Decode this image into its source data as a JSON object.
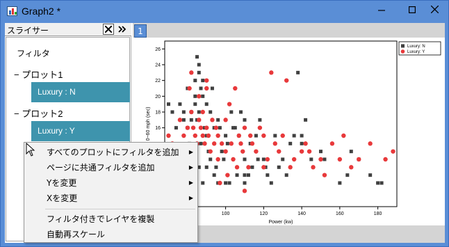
{
  "window": {
    "title": "Graph2 *"
  },
  "slicer": {
    "title": "スライサー",
    "filter_label": "フィルタ",
    "groups": [
      {
        "label": "− プロット1",
        "item": "Luxury : N"
      },
      {
        "label": "− プロット2",
        "item": "Luxury : Y"
      }
    ]
  },
  "graph": {
    "layer_tab": "1"
  },
  "context_menu": {
    "items": [
      {
        "label": "すべてのプロットにフィルタを追加",
        "submenu": true
      },
      {
        "label": "ページに共通フィルタを追加",
        "submenu": true
      },
      {
        "label": "Yを変更",
        "submenu": true
      },
      {
        "label": "Xを変更",
        "submenu": true
      },
      {
        "label": "フィルタ付きでレイヤを複製",
        "submenu": false
      },
      {
        "label": "自動再スケール",
        "submenu": false
      }
    ]
  },
  "colors": {
    "accent": "#5a8ed6",
    "selected": "#3e94ad",
    "series_n": "#404040",
    "series_y": "#e8393b"
  },
  "chart_data": {
    "type": "scatter",
    "xlabel": "Power (kw)",
    "ylabel": "0~60 mph (sec)",
    "xlim": [
      68,
      190
    ],
    "ylim": [
      6,
      27
    ],
    "xticks": [
      80,
      100,
      120,
      140,
      160,
      180
    ],
    "yticks": [
      8,
      10,
      12,
      14,
      16,
      18,
      20,
      22,
      24,
      26
    ],
    "legend_position": "top-right",
    "series": [
      {
        "name": "Luxury: N",
        "marker": "square",
        "points": [
          [
            70,
            19
          ],
          [
            72,
            18
          ],
          [
            74,
            16
          ],
          [
            76,
            19
          ],
          [
            78,
            18
          ],
          [
            78,
            17
          ],
          [
            80,
            16
          ],
          [
            80,
            21
          ],
          [
            81,
            14
          ],
          [
            82,
            18
          ],
          [
            82,
            17
          ],
          [
            83,
            12
          ],
          [
            84,
            22
          ],
          [
            84,
            19
          ],
          [
            84,
            20
          ],
          [
            85,
            25
          ],
          [
            85,
            17
          ],
          [
            86,
            24
          ],
          [
            86,
            23
          ],
          [
            86,
            18
          ],
          [
            87,
            21
          ],
          [
            87,
            14
          ],
          [
            88,
            22
          ],
          [
            88,
            20
          ],
          [
            89,
            16
          ],
          [
            90,
            15
          ],
          [
            90,
            19
          ],
          [
            91,
            13
          ],
          [
            92,
            18
          ],
          [
            92,
            12
          ],
          [
            93,
            21
          ],
          [
            94,
            16
          ],
          [
            95,
            11
          ],
          [
            96,
            17
          ],
          [
            97,
            16
          ],
          [
            98,
            13
          ],
          [
            99,
            12
          ],
          [
            100,
            15
          ],
          [
            101,
            14
          ],
          [
            102,
            9
          ],
          [
            103,
            18
          ],
          [
            104,
            16
          ],
          [
            105,
            16
          ],
          [
            106,
            10
          ],
          [
            107,
            15
          ],
          [
            108,
            18
          ],
          [
            110,
            17
          ],
          [
            110,
            12
          ],
          [
            110,
            9
          ],
          [
            112,
            10
          ],
          [
            113,
            14
          ],
          [
            114,
            11
          ],
          [
            116,
            15
          ],
          [
            117,
            12
          ],
          [
            118,
            17
          ],
          [
            120,
            12
          ],
          [
            121,
            11
          ],
          [
            122,
            10
          ],
          [
            124,
            9
          ],
          [
            126,
            15
          ],
          [
            128,
            11
          ],
          [
            130,
            12
          ],
          [
            132,
            10
          ],
          [
            134,
            14
          ],
          [
            136,
            15
          ],
          [
            138,
            23
          ],
          [
            140,
            15
          ],
          [
            140,
            14
          ],
          [
            142,
            17
          ],
          [
            145,
            12
          ],
          [
            150,
            13
          ],
          [
            152,
            12
          ],
          [
            160,
            9
          ],
          [
            164,
            10
          ],
          [
            166,
            13
          ],
          [
            170,
            12
          ],
          [
            176,
            10
          ],
          [
            180,
            9
          ],
          [
            182,
            9
          ],
          [
            78,
            10
          ],
          [
            86,
            11
          ],
          [
            90,
            11
          ],
          [
            94,
            10
          ],
          [
            110,
            10
          ],
          [
            88,
            9
          ],
          [
            80,
            10
          ],
          [
            84,
            10
          ],
          [
            96,
            9
          ],
          [
            100,
            9
          ]
        ]
      },
      {
        "name": "Luxury: Y",
        "marker": "circle",
        "points": [
          [
            70,
            15
          ],
          [
            72,
            14
          ],
          [
            76,
            17
          ],
          [
            78,
            15
          ],
          [
            80,
            16
          ],
          [
            80,
            12
          ],
          [
            81,
            21
          ],
          [
            82,
            23
          ],
          [
            82,
            18
          ],
          [
            83,
            16
          ],
          [
            84,
            15
          ],
          [
            85,
            14
          ],
          [
            86,
            17
          ],
          [
            86,
            20
          ],
          [
            87,
            16
          ],
          [
            88,
            15
          ],
          [
            88,
            18
          ],
          [
            89,
            14
          ],
          [
            90,
            21
          ],
          [
            90,
            16
          ],
          [
            91,
            15
          ],
          [
            92,
            13
          ],
          [
            93,
            17
          ],
          [
            94,
            14
          ],
          [
            95,
            16
          ],
          [
            96,
            12
          ],
          [
            96,
            15
          ],
          [
            97,
            9
          ],
          [
            98,
            14
          ],
          [
            100,
            13
          ],
          [
            100,
            17
          ],
          [
            101,
            10
          ],
          [
            102,
            19
          ],
          [
            103,
            14
          ],
          [
            104,
            12
          ],
          [
            105,
            21
          ],
          [
            106,
            11
          ],
          [
            107,
            15
          ],
          [
            108,
            14
          ],
          [
            109,
            13
          ],
          [
            110,
            16
          ],
          [
            110,
            8
          ],
          [
            112,
            11
          ],
          [
            113,
            15
          ],
          [
            114,
            14
          ],
          [
            116,
            13
          ],
          [
            118,
            16
          ],
          [
            120,
            15
          ],
          [
            120,
            11
          ],
          [
            122,
            12
          ],
          [
            124,
            23
          ],
          [
            126,
            14
          ],
          [
            128,
            13
          ],
          [
            130,
            15
          ],
          [
            132,
            22
          ],
          [
            134,
            11
          ],
          [
            136,
            12
          ],
          [
            140,
            13
          ],
          [
            142,
            14
          ],
          [
            144,
            13
          ],
          [
            146,
            11
          ],
          [
            150,
            12
          ],
          [
            152,
            10
          ],
          [
            156,
            14
          ],
          [
            160,
            12
          ],
          [
            162,
            15
          ],
          [
            166,
            11
          ],
          [
            170,
            12
          ],
          [
            176,
            14
          ],
          [
            184,
            12
          ],
          [
            188,
            13
          ],
          [
            79,
            8
          ],
          [
            90,
            22
          ]
        ]
      }
    ]
  }
}
